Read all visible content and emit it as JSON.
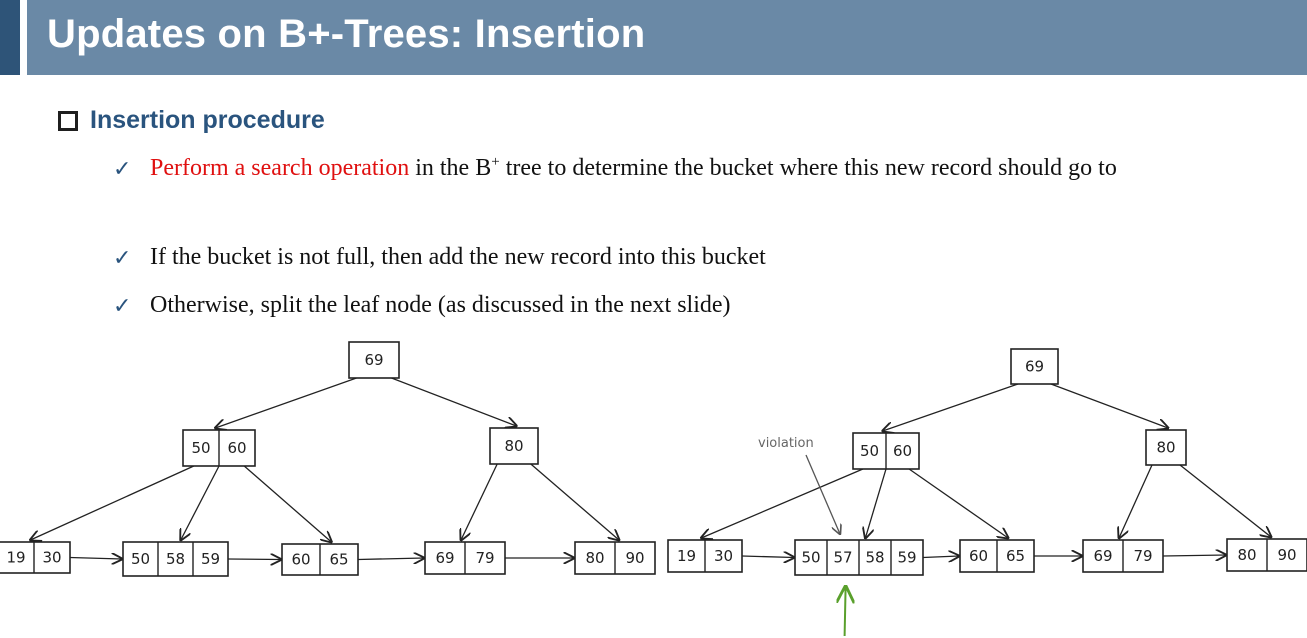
{
  "slide": {
    "title": "Updates on B+-Trees:  Insertion",
    "section": "Insertion procedure",
    "bullets": [
      {
        "highlight": "Perform a search operation",
        "before_sup": " in the B",
        "sup": "+",
        "after_sup": " tree to determine the bucket where this new record should go to"
      },
      {
        "text": "If the bucket is not full, then add the new record into this bucket"
      },
      {
        "text": "Otherwise, split the leaf node (as discussed in the next slide)"
      }
    ],
    "colors": {
      "title_bar": "#6a89a6",
      "accent_bar": "#2e5478",
      "section_text": "#2a547e",
      "highlight": "#e01010",
      "arrow_green": "#5aa02c"
    }
  },
  "diagram": {
    "trees": [
      {
        "id": "before",
        "nodes": [
          {
            "id": "root",
            "keys": [
              "69"
            ]
          },
          {
            "id": "i1",
            "keys": [
              "50",
              "60"
            ]
          },
          {
            "id": "i2",
            "keys": [
              "80"
            ]
          },
          {
            "id": "l1",
            "keys": [
              "19",
              "30"
            ]
          },
          {
            "id": "l2",
            "keys": [
              "50",
              "58",
              "59"
            ]
          },
          {
            "id": "l3",
            "keys": [
              "60",
              "65"
            ]
          },
          {
            "id": "l4",
            "keys": [
              "69",
              "79"
            ]
          },
          {
            "id": "l5",
            "keys": [
              "80",
              "90"
            ]
          }
        ]
      },
      {
        "id": "after",
        "annotation": "violation",
        "nodes": [
          {
            "id": "root",
            "keys": [
              "69"
            ]
          },
          {
            "id": "i1",
            "keys": [
              "50",
              "60"
            ]
          },
          {
            "id": "i2",
            "keys": [
              "80"
            ]
          },
          {
            "id": "l1",
            "keys": [
              "19",
              "30"
            ]
          },
          {
            "id": "l2",
            "keys": [
              "50",
              "57",
              "58",
              "59"
            ]
          },
          {
            "id": "l3",
            "keys": [
              "60",
              "65"
            ]
          },
          {
            "id": "l4",
            "keys": [
              "69",
              "79"
            ]
          },
          {
            "id": "l5",
            "keys": [
              "80",
              "90"
            ]
          }
        ]
      }
    ]
  }
}
